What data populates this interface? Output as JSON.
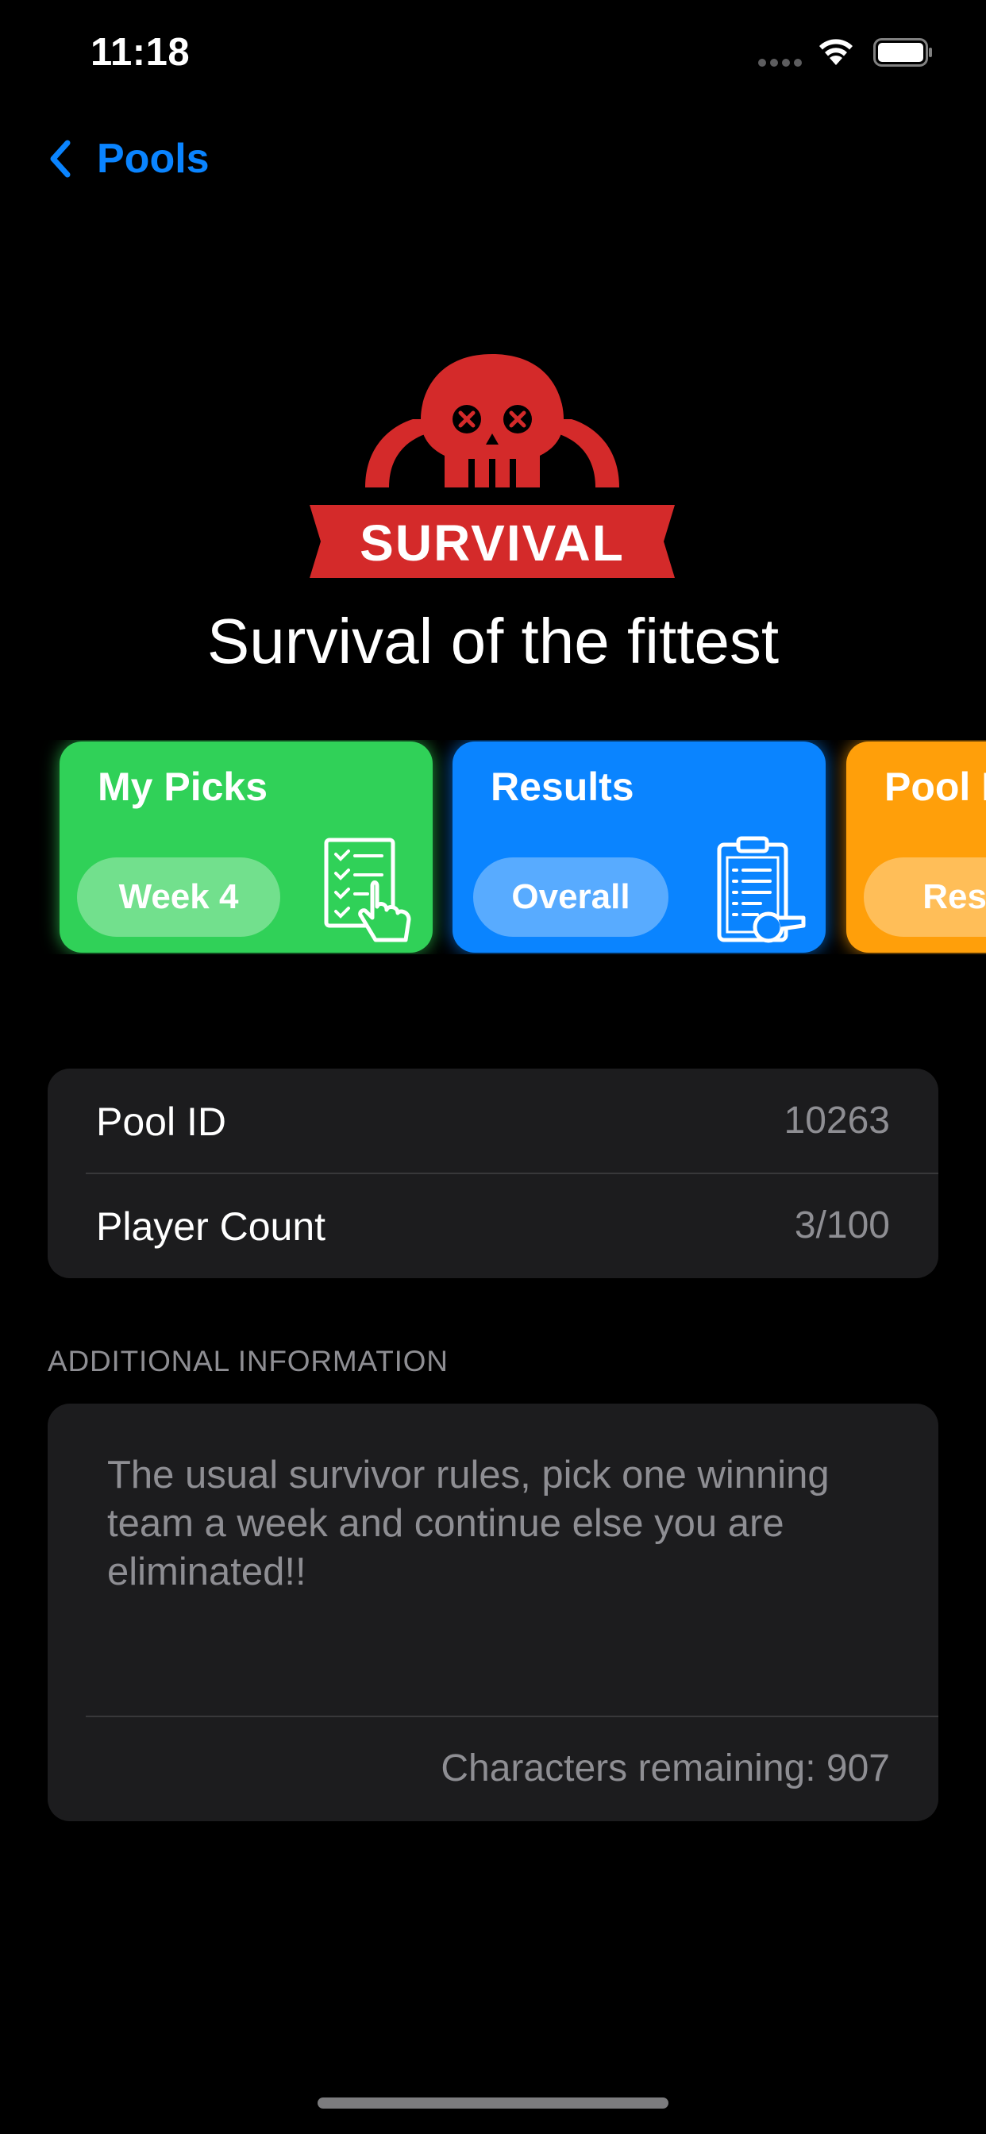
{
  "status_bar": {
    "time": "11:18"
  },
  "nav": {
    "back_label": "Pools"
  },
  "logo": {
    "text": "SURVIVAL",
    "color": "#d42a2a"
  },
  "pool": {
    "title": "Survival of the fittest"
  },
  "cards": [
    {
      "title": "My Picks",
      "pill": "Week 4",
      "color": "#30d158",
      "icon": "checklist-tap-icon"
    },
    {
      "title": "Results",
      "pill": "Overall",
      "color": "#0a84ff",
      "icon": "clipboard-whistle-icon"
    },
    {
      "title": "Pool I",
      "pill": "Resu",
      "color": "#ff9f0a"
    }
  ],
  "details": {
    "pool_id_label": "Pool ID",
    "pool_id_value": "10263",
    "player_count_label": "Player Count",
    "player_count_value": "3/100"
  },
  "additional": {
    "header": "ADDITIONAL INFORMATION",
    "text": "The usual survivor rules, pick one winning team a week and continue else you are eliminated!!",
    "counter": "Characters remaining: 907"
  },
  "colors": {
    "accent": "#0a84ff",
    "background": "#000000",
    "group": "#1c1c1e",
    "secondary_text": "#8e8e93"
  }
}
